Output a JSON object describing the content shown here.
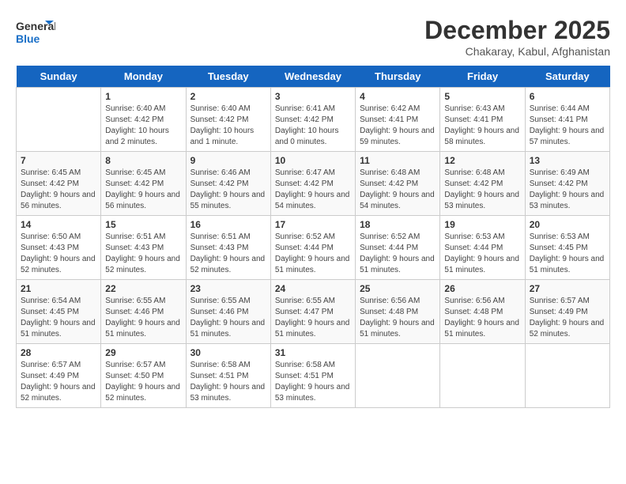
{
  "header": {
    "logo_line1": "General",
    "logo_line2": "Blue",
    "month": "December 2025",
    "location": "Chakaray, Kabul, Afghanistan"
  },
  "days_of_week": [
    "Sunday",
    "Monday",
    "Tuesday",
    "Wednesday",
    "Thursday",
    "Friday",
    "Saturday"
  ],
  "weeks": [
    [
      {
        "day": "",
        "content": ""
      },
      {
        "day": "1",
        "content": "Sunrise: 6:40 AM\nSunset: 4:42 PM\nDaylight: 10 hours\nand 2 minutes."
      },
      {
        "day": "2",
        "content": "Sunrise: 6:40 AM\nSunset: 4:42 PM\nDaylight: 10 hours\nand 1 minute."
      },
      {
        "day": "3",
        "content": "Sunrise: 6:41 AM\nSunset: 4:42 PM\nDaylight: 10 hours\nand 0 minutes."
      },
      {
        "day": "4",
        "content": "Sunrise: 6:42 AM\nSunset: 4:41 PM\nDaylight: 9 hours\nand 59 minutes."
      },
      {
        "day": "5",
        "content": "Sunrise: 6:43 AM\nSunset: 4:41 PM\nDaylight: 9 hours\nand 58 minutes."
      },
      {
        "day": "6",
        "content": "Sunrise: 6:44 AM\nSunset: 4:41 PM\nDaylight: 9 hours\nand 57 minutes."
      }
    ],
    [
      {
        "day": "7",
        "content": "Sunrise: 6:45 AM\nSunset: 4:42 PM\nDaylight: 9 hours\nand 56 minutes."
      },
      {
        "day": "8",
        "content": "Sunrise: 6:45 AM\nSunset: 4:42 PM\nDaylight: 9 hours\nand 56 minutes."
      },
      {
        "day": "9",
        "content": "Sunrise: 6:46 AM\nSunset: 4:42 PM\nDaylight: 9 hours\nand 55 minutes."
      },
      {
        "day": "10",
        "content": "Sunrise: 6:47 AM\nSunset: 4:42 PM\nDaylight: 9 hours\nand 54 minutes."
      },
      {
        "day": "11",
        "content": "Sunrise: 6:48 AM\nSunset: 4:42 PM\nDaylight: 9 hours\nand 54 minutes."
      },
      {
        "day": "12",
        "content": "Sunrise: 6:48 AM\nSunset: 4:42 PM\nDaylight: 9 hours\nand 53 minutes."
      },
      {
        "day": "13",
        "content": "Sunrise: 6:49 AM\nSunset: 4:42 PM\nDaylight: 9 hours\nand 53 minutes."
      }
    ],
    [
      {
        "day": "14",
        "content": "Sunrise: 6:50 AM\nSunset: 4:43 PM\nDaylight: 9 hours\nand 52 minutes."
      },
      {
        "day": "15",
        "content": "Sunrise: 6:51 AM\nSunset: 4:43 PM\nDaylight: 9 hours\nand 52 minutes."
      },
      {
        "day": "16",
        "content": "Sunrise: 6:51 AM\nSunset: 4:43 PM\nDaylight: 9 hours\nand 52 minutes."
      },
      {
        "day": "17",
        "content": "Sunrise: 6:52 AM\nSunset: 4:44 PM\nDaylight: 9 hours\nand 51 minutes."
      },
      {
        "day": "18",
        "content": "Sunrise: 6:52 AM\nSunset: 4:44 PM\nDaylight: 9 hours\nand 51 minutes."
      },
      {
        "day": "19",
        "content": "Sunrise: 6:53 AM\nSunset: 4:44 PM\nDaylight: 9 hours\nand 51 minutes."
      },
      {
        "day": "20",
        "content": "Sunrise: 6:53 AM\nSunset: 4:45 PM\nDaylight: 9 hours\nand 51 minutes."
      }
    ],
    [
      {
        "day": "21",
        "content": "Sunrise: 6:54 AM\nSunset: 4:45 PM\nDaylight: 9 hours\nand 51 minutes."
      },
      {
        "day": "22",
        "content": "Sunrise: 6:55 AM\nSunset: 4:46 PM\nDaylight: 9 hours\nand 51 minutes."
      },
      {
        "day": "23",
        "content": "Sunrise: 6:55 AM\nSunset: 4:46 PM\nDaylight: 9 hours\nand 51 minutes."
      },
      {
        "day": "24",
        "content": "Sunrise: 6:55 AM\nSunset: 4:47 PM\nDaylight: 9 hours\nand 51 minutes."
      },
      {
        "day": "25",
        "content": "Sunrise: 6:56 AM\nSunset: 4:48 PM\nDaylight: 9 hours\nand 51 minutes."
      },
      {
        "day": "26",
        "content": "Sunrise: 6:56 AM\nSunset: 4:48 PM\nDaylight: 9 hours\nand 51 minutes."
      },
      {
        "day": "27",
        "content": "Sunrise: 6:57 AM\nSunset: 4:49 PM\nDaylight: 9 hours\nand 52 minutes."
      }
    ],
    [
      {
        "day": "28",
        "content": "Sunrise: 6:57 AM\nSunset: 4:49 PM\nDaylight: 9 hours\nand 52 minutes."
      },
      {
        "day": "29",
        "content": "Sunrise: 6:57 AM\nSunset: 4:50 PM\nDaylight: 9 hours\nand 52 minutes."
      },
      {
        "day": "30",
        "content": "Sunrise: 6:58 AM\nSunset: 4:51 PM\nDaylight: 9 hours\nand 53 minutes."
      },
      {
        "day": "31",
        "content": "Sunrise: 6:58 AM\nSunset: 4:51 PM\nDaylight: 9 hours\nand 53 minutes."
      },
      {
        "day": "",
        "content": ""
      },
      {
        "day": "",
        "content": ""
      },
      {
        "day": "",
        "content": ""
      }
    ]
  ]
}
